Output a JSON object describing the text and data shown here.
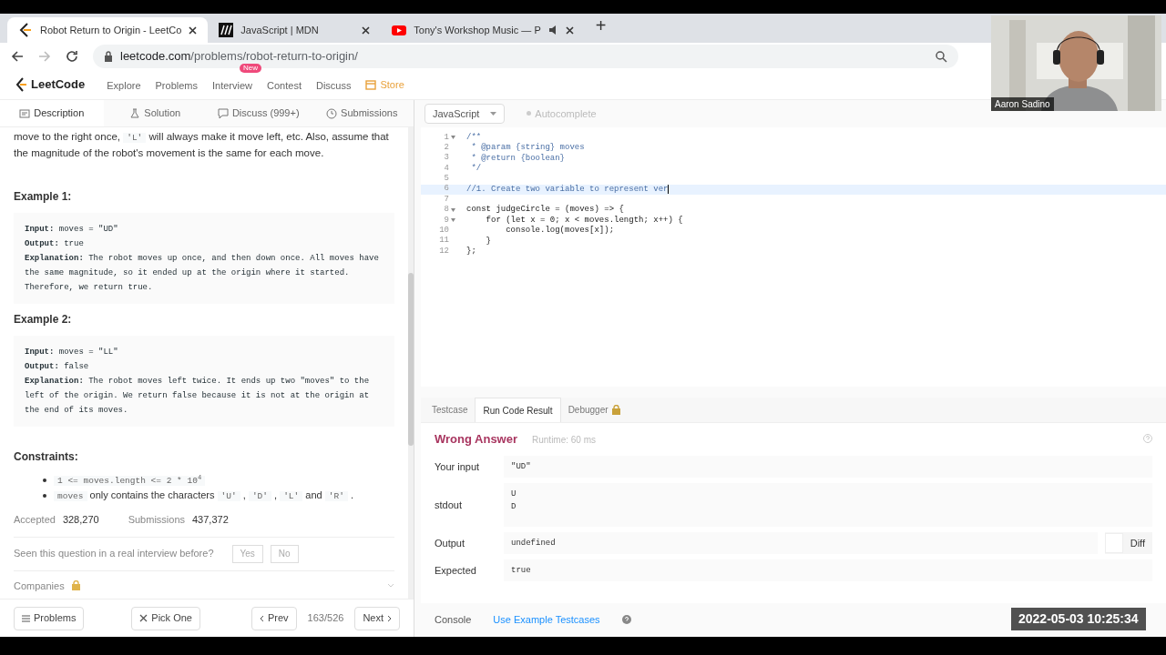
{
  "browser_tabs": [
    {
      "title": "Robot Return to Origin - LeetCo",
      "selected": true,
      "audio": false
    },
    {
      "title": "JavaScript | MDN",
      "selected": false,
      "audio": false
    },
    {
      "title": "Tony's Workshop Music — P",
      "selected": false,
      "audio": true
    }
  ],
  "new_tab": "+",
  "address": {
    "host": "leetcode.com",
    "path": "/problems/robot-return-to-origin/"
  },
  "site_nav": {
    "brand": "LeetCode",
    "items": [
      {
        "label": "Explore",
        "kind": "link"
      },
      {
        "label": "Problems",
        "kind": "link"
      },
      {
        "label": "Interview",
        "kind": "link",
        "badge": "New"
      },
      {
        "label": "Contest",
        "kind": "link"
      },
      {
        "label": "Discuss",
        "kind": "link"
      },
      {
        "label": "Store",
        "kind": "store"
      }
    ]
  },
  "panel_tabs": [
    {
      "label": "Description",
      "selected": true
    },
    {
      "label": "Solution",
      "selected": false
    },
    {
      "label": "Discuss (999+)",
      "selected": false
    },
    {
      "label": "Submissions",
      "selected": false
    }
  ],
  "description": {
    "intro": [
      {
        "kind": "text",
        "text": "move to the right once,"
      },
      {
        "kind": "code",
        "text": "'L'"
      },
      {
        "kind": "text",
        "text": "will always make it move left, etc. Also, assume that the magnitude of the robot's movement is the same for each move."
      }
    ],
    "examples": [
      {
        "title": "Example 1:",
        "lines": [
          "**Input:** moves = \"UD\"",
          "**Output:** true",
          "**Explanation:** The robot moves up once, and then down once. All moves have the same magnitude, so it ended up at the origin where it started. Therefore, we return true."
        ]
      },
      {
        "title": "Example 2:",
        "lines": [
          "**Input:** moves = \"LL\"",
          "**Output:** false",
          "**Explanation:** The robot moves left twice. It ends up two \"moves\" to the left of the origin. We return false because it is not at the origin at the end of its moves."
        ]
      }
    ],
    "constraints_title": "Constraints:",
    "constraints": [
      [
        {
          "kind": "code",
          "text": "1 <= moves.length <= 2 * 10$^{4}$"
        }
      ],
      [
        {
          "kind": "code",
          "text": "moves"
        },
        {
          "kind": "text",
          "text": "only contains the characters"
        },
        {
          "kind": "code",
          "text": "'U'"
        },
        {
          "kind": "text",
          "text": ","
        },
        {
          "kind": "code",
          "text": "'D'"
        },
        {
          "kind": "text",
          "text": ","
        },
        {
          "kind": "code",
          "text": "'L'"
        },
        {
          "kind": "text",
          "text": "and"
        },
        {
          "kind": "code",
          "text": "'R'"
        },
        {
          "kind": "text",
          "text": "."
        }
      ]
    ],
    "stats": [
      {
        "label": "Accepted",
        "value": "328,270"
      },
      {
        "label": "Submissions",
        "value": "437,372"
      }
    ],
    "interview_question": "Seen this question in a real interview before?",
    "answers": [
      "Yes",
      "No"
    ],
    "companies": "Companies"
  },
  "footer": {
    "problems": "Problems",
    "pick_one": "Pick One",
    "prev": "Prev",
    "position": "163/526",
    "next": "Next"
  },
  "editor": {
    "language": "JavaScript",
    "autocomplete": "Autocomplete",
    "lines": [
      {
        "number": "1",
        "text": "/**",
        "kind": "comment",
        "fold": true,
        "current": false
      },
      {
        "number": "2",
        "text": " * @param {string} moves",
        "kind": "comment",
        "fold": false,
        "current": false
      },
      {
        "number": "3",
        "text": " * @return {boolean}",
        "kind": "comment",
        "fold": false,
        "current": false
      },
      {
        "number": "4",
        "text": " */",
        "kind": "comment",
        "fold": false,
        "current": false
      },
      {
        "number": "5",
        "fold": false,
        "current": false
      },
      {
        "number": "6",
        "text": "//1. Create two variable to represent ver",
        "kind": "comment",
        "fold": false,
        "current": true
      },
      {
        "number": "7",
        "fold": false,
        "current": false
      },
      {
        "number": "8",
        "text": "const judgeCircle = (moves) => {",
        "kind": "code",
        "fold": true,
        "current": false
      },
      {
        "number": "9",
        "text": "    for (let x = 0; x < moves.length; x++) {",
        "kind": "code",
        "fold": true,
        "current": false
      },
      {
        "number": "10",
        "text": "        console.log(moves[x]);",
        "kind": "code",
        "fold": false,
        "current": false
      },
      {
        "number": "11",
        "text": "    }",
        "kind": "code",
        "fold": false,
        "current": false
      },
      {
        "number": "12",
        "text": "};",
        "kind": "code",
        "fold": false,
        "current": false
      }
    ]
  },
  "result_tabs": [
    {
      "label": "Testcase",
      "selected": false,
      "locked": false
    },
    {
      "label": "Run Code Result",
      "selected": true,
      "locked": false
    },
    {
      "label": "Debugger",
      "selected": false,
      "locked": true
    }
  ],
  "result": {
    "verdict": "Wrong Answer",
    "runtime": "Runtime: 60 ms",
    "rows": [
      {
        "label": "Your input",
        "lines": [
          "\"UD\""
        ]
      },
      {
        "label": "stdout",
        "lines": [
          "U",
          "D"
        ]
      },
      {
        "label": "Output",
        "lines": [
          "undefined"
        ],
        "diff": "Diff"
      },
      {
        "label": "Expected",
        "lines": [
          "true"
        ]
      }
    ]
  },
  "console_bar": {
    "console": "Console",
    "testcases": "Use Example Testcases"
  },
  "webcam": {
    "name": "Aaron Sadino"
  },
  "timestamp": "2022-05-03 10:25:34"
}
